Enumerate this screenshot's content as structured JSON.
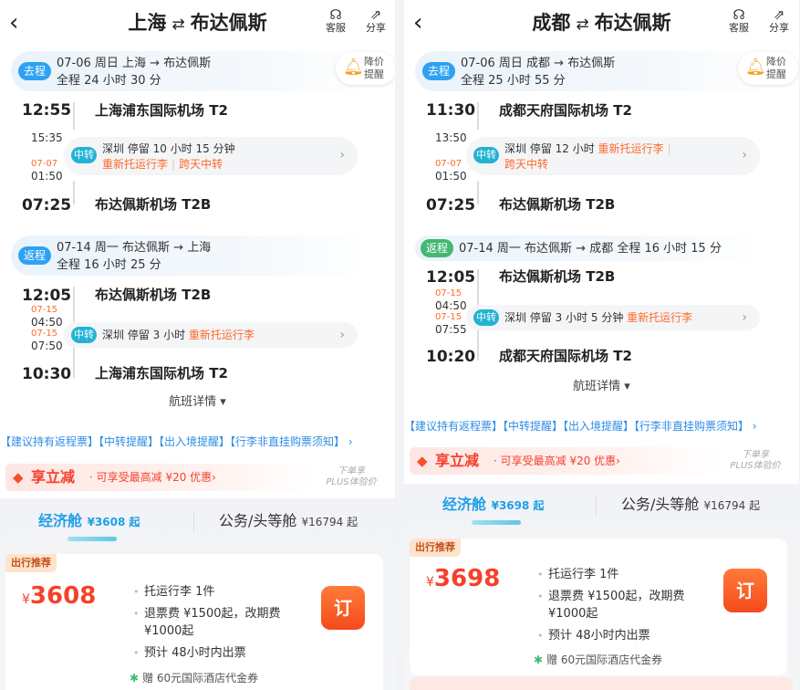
{
  "left": {
    "header": {
      "origin": "上海",
      "swap_glyph": "⇄",
      "dest": "布达佩斯",
      "actions": [
        {
          "icon": "headset-icon",
          "label": "客服"
        },
        {
          "icon": "share-icon",
          "label": "分享"
        }
      ]
    },
    "outbound": {
      "badge": "去程",
      "date_line": "07-06 周日   上海 → 布达佩斯",
      "duration": "全程 24 小时 30 分",
      "depart_time": "12:55",
      "depart_airport": "上海浦东国际机场 T2",
      "transfer": {
        "arrive": "15:35",
        "next_day": "07-07",
        "depart": "01:50",
        "badge": "中转",
        "line1": "深圳  停留 10 小时 15 分钟",
        "line2a": "重新托运行李",
        "line2b": "跨天中转"
      },
      "arrive_time": "07:25",
      "arrive_airport": "布达佩斯机场 T2B"
    },
    "price_alert": {
      "label": "降价\n提醒"
    },
    "return": {
      "badge": "返程",
      "date_line": "07-14 周一   布达佩斯 → 上海",
      "duration": "全程 16 小时 25 分",
      "depart_time": "12:05",
      "depart_airport": "布达佩斯机场 T2B",
      "transfer": {
        "arrive_day": "07-15",
        "arrive": "04:50",
        "depart_day": "07-15",
        "depart": "07:50",
        "badge": "中转",
        "line1": "深圳  停留 3 小时",
        "line1b": "重新托运行李"
      },
      "arrive_time": "10:30",
      "arrive_airport": "上海浦东国际机场 T2"
    },
    "flight_detail": "航班详情 ▾",
    "notes": "【建议持有返程票】【中转提醒】【出入境提醒】【行李非直挂购票须知】 ›",
    "promo": {
      "main": "享立减",
      "sub": "· 可享受最高减 ¥20 优惠›",
      "side1": "下单享",
      "side2": "PLUS体验价"
    },
    "tabs": [
      {
        "label": "经济舱",
        "price": "¥3608 起"
      },
      {
        "label": "公务/头等舱",
        "price": "¥16794 起"
      }
    ],
    "offer": {
      "tag": "出行推荐",
      "currency": "¥",
      "price": "3608",
      "features": [
        "托运行李 1件",
        "退票费 ¥1500起，改期费 ¥1000起",
        "预计 48小时内出票"
      ],
      "book": "订",
      "gift": "赠 60元国际酒店代金券"
    }
  },
  "right": {
    "header": {
      "origin": "成都",
      "swap_glyph": "⇄",
      "dest": "布达佩斯",
      "actions": [
        {
          "icon": "headset-icon",
          "label": "客服"
        },
        {
          "icon": "share-icon",
          "label": "分享"
        }
      ]
    },
    "outbound": {
      "badge": "去程",
      "date_line": "07-06 周日   成都 → 布达佩斯",
      "duration": "全程 25 小时 55 分",
      "depart_time": "11:30",
      "depart_airport": "成都天府国际机场 T2",
      "transfer": {
        "arrive": "13:50",
        "next_day": "07-07",
        "depart": "01:50",
        "badge": "中转",
        "line1": "深圳  停留 12 小时",
        "line1b": "重新托运行李",
        "line2": "跨天中转"
      },
      "arrive_time": "07:25",
      "arrive_airport": "布达佩斯机场 T2B"
    },
    "price_alert": {
      "label": "降价\n提醒"
    },
    "return": {
      "badge": "返程",
      "date_line": "07-14 周一   布达佩斯 → 成都   全程 16 小时 15 分",
      "depart_time": "12:05",
      "depart_airport": "布达佩斯机场 T2B",
      "transfer": {
        "arrive_day": "07-15",
        "arrive": "04:50",
        "depart_day": "07-15",
        "depart": "07:55",
        "badge": "中转",
        "line1": "深圳  停留 3 小时 5 分钟",
        "line1b": "重新托运行李"
      },
      "arrive_time": "10:20",
      "arrive_airport": "成都天府国际机场 T2"
    },
    "flight_detail": "航班详情 ▾",
    "notes": "【建议持有返程票】【中转提醒】【出入境提醒】【行李非直挂购票须知】 ›",
    "promo": {
      "main": "享立减",
      "sub": "· 可享受最高减 ¥20 优惠›",
      "side1": "下单享",
      "side2": "PLUS体验价"
    },
    "tabs": [
      {
        "label": "经济舱",
        "price": "¥3698 起"
      },
      {
        "label": "公务/头等舱",
        "price": "¥16794 起"
      }
    ],
    "offer": {
      "tag": "出行推荐",
      "currency": "¥",
      "price": "3698",
      "features": [
        "托运行李 1件",
        "退票费 ¥1500起，改期费 ¥1000起",
        "预计 48小时内出票"
      ],
      "book": "订",
      "gift": "赠 60元国际酒店代金券"
    }
  }
}
